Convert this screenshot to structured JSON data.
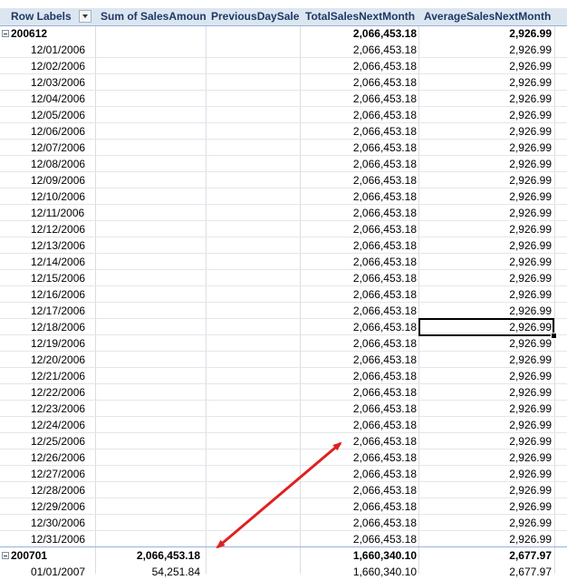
{
  "header": {
    "row_labels": "Row Labels",
    "sum_sales": "Sum of SalesAmount",
    "prev_day": "PreviousDaySales",
    "total_next": "TotalSalesNextMonth",
    "avg_next": "AverageSalesNextMonth"
  },
  "group1": {
    "label": "200612",
    "total_next": "2,066,453.18",
    "avg_next": "2,926.99"
  },
  "dates": [
    "12/01/2006",
    "12/02/2006",
    "12/03/2006",
    "12/04/2006",
    "12/05/2006",
    "12/06/2006",
    "12/07/2006",
    "12/08/2006",
    "12/09/2006",
    "12/10/2006",
    "12/11/2006",
    "12/12/2006",
    "12/13/2006",
    "12/14/2006",
    "12/15/2006",
    "12/16/2006",
    "12/17/2006",
    "12/18/2006",
    "12/19/2006",
    "12/20/2006",
    "12/21/2006",
    "12/22/2006",
    "12/23/2006",
    "12/24/2006",
    "12/25/2006",
    "12/26/2006",
    "12/27/2006",
    "12/28/2006",
    "12/29/2006",
    "12/30/2006",
    "12/31/2006"
  ],
  "row_total_next": "2,066,453.18",
  "row_avg_next": "2,926.99",
  "group2": {
    "label": "200701",
    "sum_sales": "2,066,453.18",
    "total_next": "1,660,340.10",
    "avg_next": "2,677.97"
  },
  "last_row": {
    "date": "01/01/2007",
    "sum_sales": "54,251.84",
    "total_next": "1,660,340.10",
    "avg_next": "2,677.97"
  },
  "colors": {
    "header_bg": "#dce6f1",
    "arrow": "#e02020"
  }
}
